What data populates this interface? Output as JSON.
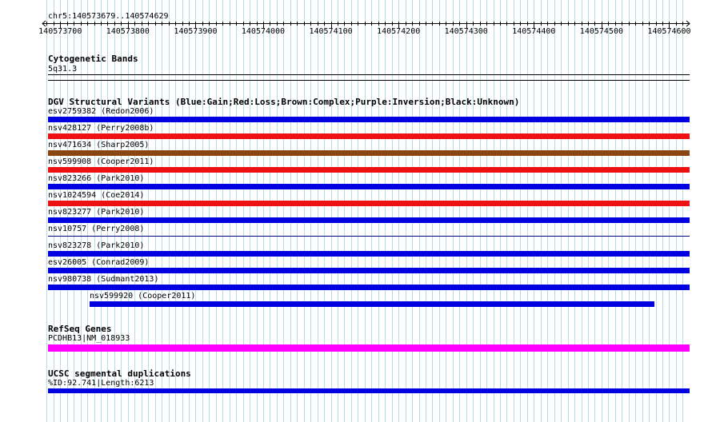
{
  "ruler": {
    "region": "chr5:140573679..140574629",
    "ticks": [
      "140573700",
      "140573800",
      "140573900",
      "140574000",
      "140574100",
      "140574200",
      "140574300",
      "140574400",
      "140574500",
      "140574600"
    ]
  },
  "tracks": {
    "cytoband": {
      "title": "Cytogenetic Bands",
      "band": "5q31.3"
    },
    "dgv": {
      "title": "DGV Structural Variants (Blue:Gain;Red:Loss;Brown:Complex;Purple:Inversion;Black:Unknown)",
      "features": [
        {
          "label": "esv2759382 (Redon2006)",
          "color": "#0000e0",
          "type": "Gain"
        },
        {
          "label": "nsv428127 (Perry2008b)",
          "color": "#ee1111",
          "type": "Loss"
        },
        {
          "label": "nsv471634 (Sharp2005)",
          "color": "#8b4513",
          "type": "Complex"
        },
        {
          "label": "nsv599908 (Cooper2011)",
          "color": "#ee1111",
          "type": "Loss"
        },
        {
          "label": "nsv823266 (Park2010)",
          "color": "#0000e0",
          "type": "Gain"
        },
        {
          "label": "nsv1024594 (Coe2014)",
          "color": "#ee1111",
          "type": "Loss"
        },
        {
          "label": "nsv823277 (Park2010)",
          "color": "#0000e0",
          "type": "Gain"
        },
        {
          "label": "nsv10757 (Perry2008)",
          "color": "#000080",
          "type": "Unknown"
        },
        {
          "label": "nsv823278 (Park2010)",
          "color": "#0000e0",
          "type": "Gain"
        },
        {
          "label": "esv26005 (Conrad2009)",
          "color": "#0000e0",
          "type": "Gain"
        },
        {
          "label": "nsv980738 (Sudmant2013)",
          "color": "#0000e0",
          "type": "Gain"
        },
        {
          "label": "nsv599920 (Cooper2011)",
          "color": "#0000e0",
          "type": "Gain"
        }
      ]
    },
    "refseq": {
      "title": "RefSeq Genes",
      "feature_label": "PCDHB13|NM_018933",
      "color": "#ff00ff"
    },
    "segdups": {
      "title": "UCSC segmental duplications",
      "feature_label": "%ID:92.741|Length:6213",
      "color": "#0000e0"
    }
  },
  "colors": {
    "grid": "#b8dbe8",
    "gain": "#0000e0",
    "loss": "#ee1111",
    "complex": "#8b4513",
    "refseq": "#ff00ff"
  }
}
